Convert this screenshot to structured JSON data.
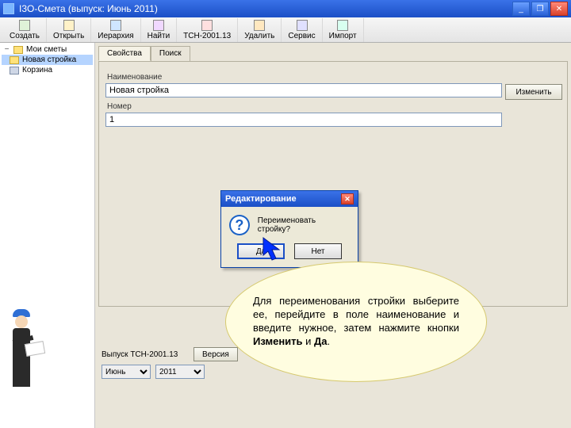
{
  "window": {
    "title": "I3О-Смета (выпуск: Июнь 2011)"
  },
  "toolbar": {
    "items": [
      "Создать",
      "Открыть",
      "Иерархия",
      "Найти",
      "ТСН-2001.13",
      "Удалить",
      "Сервис",
      "Импорт"
    ]
  },
  "sidebar": {
    "header": "Мои сметы",
    "items": [
      {
        "label": "Новая стройка",
        "selected": true
      },
      {
        "label": "Корзина",
        "selected": false
      }
    ]
  },
  "tabs": {
    "items": [
      "Свойства",
      "Поиск"
    ],
    "active": 0
  },
  "form": {
    "name_label": "Наименование",
    "name_value": "Новая стройка",
    "change_btn": "Изменить",
    "number_label": "Номер",
    "number_value": "1"
  },
  "dialog": {
    "title": "Редактирование",
    "message": "Переименовать стройку?",
    "yes": "Да",
    "no": "Нет"
  },
  "selectors": {
    "label": "Выпуск ТСН-2001.13",
    "version_btn": "Версия",
    "month_value": "Июнь",
    "year_value": "2011"
  },
  "callout": {
    "text_plain": "Для переименования стройки выберите ее, перейдите в поле наименование и введите нужное, затем нажмите кнопки Изменить и Да."
  }
}
